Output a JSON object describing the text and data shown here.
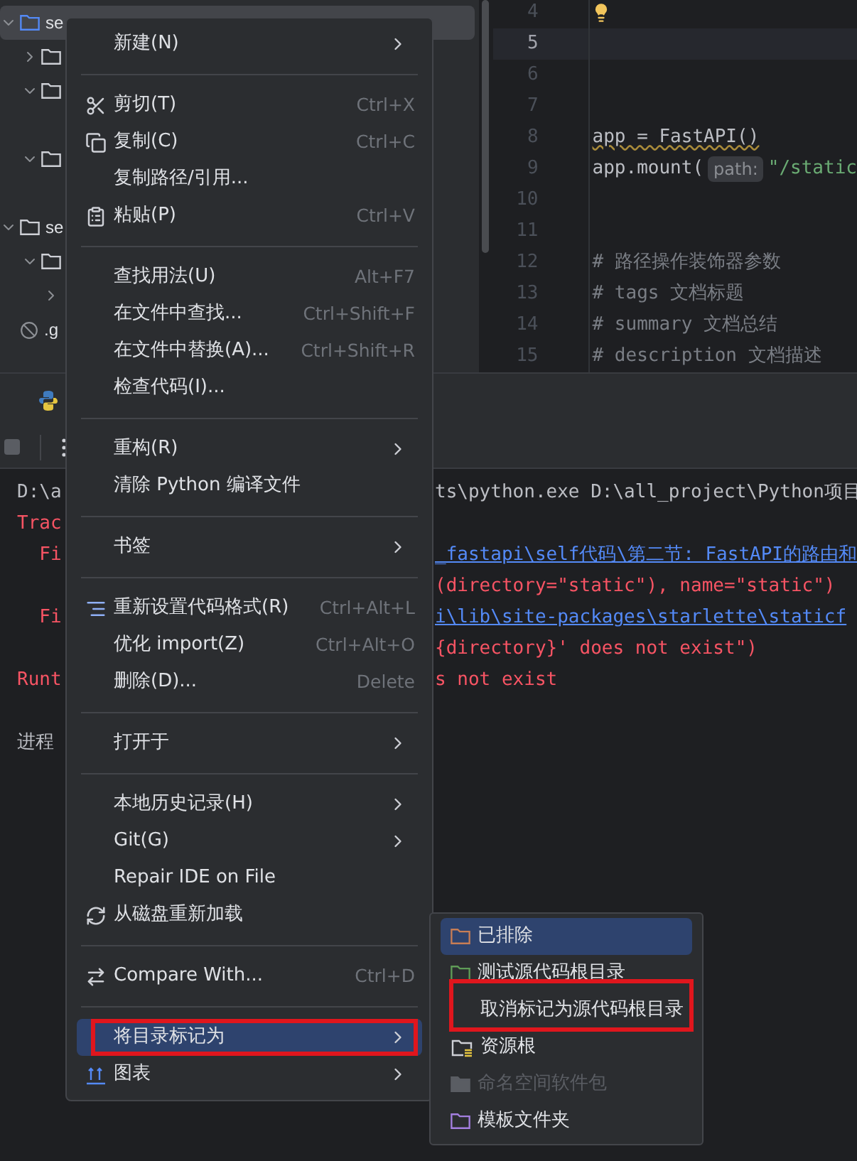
{
  "project_tree": [
    {
      "label": "se",
      "expanded": true,
      "selected": true,
      "children": [
        {
          "expanded": false
        },
        {
          "expanded": true
        },
        {
          "expanded": true
        }
      ]
    },
    {
      "label": "se",
      "expanded": true,
      "selected": false,
      "children": [
        {
          "expanded": true,
          "children": [
            {
              "expanded": false
            }
          ]
        }
      ]
    },
    {
      "label": ".g",
      "kind": "ignored",
      "selected": false
    }
  ],
  "editor": {
    "lines": [
      {
        "number": "4",
        "bulb": true,
        "current": false
      },
      {
        "number": "5",
        "bulb": false,
        "current": true
      },
      {
        "number": "6",
        "bulb": false,
        "current": false
      },
      {
        "number": "7",
        "bulb": false,
        "current": false
      },
      {
        "number": "8",
        "bulb": false,
        "current": false,
        "segments": [
          {
            "kind": "warn",
            "text": "app = FastAPI()"
          }
        ]
      },
      {
        "number": "9",
        "bulb": false,
        "current": false,
        "segments": [
          {
            "kind": "plain",
            "text": "app.mount("
          },
          {
            "kind": "hint",
            "text": "path:"
          },
          {
            "kind": "string",
            "text": "\"/static"
          }
        ]
      },
      {
        "number": "10",
        "bulb": false,
        "current": false
      },
      {
        "number": "11",
        "bulb": false,
        "current": false
      },
      {
        "number": "12",
        "bulb": false,
        "current": false,
        "segments": [
          {
            "kind": "comment",
            "text": "# 路径操作装饰器参数"
          }
        ]
      },
      {
        "number": "13",
        "bulb": false,
        "current": false,
        "segments": [
          {
            "kind": "comment",
            "text": "# tags 文档标题"
          }
        ]
      },
      {
        "number": "14",
        "bulb": false,
        "current": false,
        "segments": [
          {
            "kind": "comment",
            "text": "# summary 文档总结"
          }
        ]
      },
      {
        "number": "15",
        "bulb": false,
        "current": false,
        "segments": [
          {
            "kind": "comment",
            "text": "# description 文档描述"
          }
        ]
      }
    ]
  },
  "console": {
    "lines": [
      {
        "left": {
          "kind": "text",
          "text": "D:\\a"
        },
        "right": {
          "kind": "text",
          "text": "ts\\python.exe D:\\all_project\\Python项目"
        }
      },
      {
        "left": {
          "kind": "error",
          "text": "Trac"
        }
      },
      {
        "left": {
          "kind": "error",
          "text": "  Fi"
        },
        "right": {
          "kind": "link",
          "text": "_fastapi\\self代码\\第二节: FastAPI的路由和"
        }
      },
      {
        "right": {
          "kind": "error",
          "text": "(directory=\"static\"), name=\"static\")"
        }
      },
      {
        "left": {
          "kind": "error",
          "text": "  Fi"
        },
        "right": {
          "kind": "link",
          "text": "i\\lib\\site-packages\\starlette\\staticf"
        }
      },
      {
        "right": {
          "kind": "error",
          "text": "{directory}' does not exist\")"
        }
      },
      {
        "left": {
          "kind": "error",
          "text": "Runt"
        },
        "right": {
          "kind": "error",
          "text": "s not exist"
        }
      },
      {
        "gap_before": true,
        "left": {
          "kind": "text",
          "text": "进程"
        }
      }
    ]
  },
  "context_menu": {
    "items": [
      {
        "kind": "plain",
        "label": "新建(N)",
        "submenu": true,
        "selected": false
      },
      {
        "kind": "separator"
      },
      {
        "kind": "cut",
        "label": "剪切(T)",
        "shortcut": "Ctrl+X",
        "selected": false
      },
      {
        "kind": "copy",
        "label": "复制(C)",
        "shortcut": "Ctrl+C",
        "selected": false
      },
      {
        "kind": "plain",
        "label": "复制路径/引用...",
        "selected": false
      },
      {
        "kind": "paste",
        "label": "粘贴(P)",
        "shortcut": "Ctrl+V",
        "selected": false
      },
      {
        "kind": "separator"
      },
      {
        "kind": "plain",
        "label": "查找用法(U)",
        "shortcut": "Alt+F7",
        "selected": false
      },
      {
        "kind": "plain",
        "label": "在文件中查找...",
        "shortcut": "Ctrl+Shift+F",
        "selected": false
      },
      {
        "kind": "plain",
        "label": "在文件中替换(A)...",
        "shortcut": "Ctrl+Shift+R",
        "selected": false
      },
      {
        "kind": "plain",
        "label": "检查代码(I)...",
        "selected": false
      },
      {
        "kind": "separator"
      },
      {
        "kind": "plain",
        "label": "重构(R)",
        "submenu": true,
        "selected": false
      },
      {
        "kind": "plain",
        "label": "清除 Python 编译文件",
        "selected": false
      },
      {
        "kind": "separator"
      },
      {
        "kind": "plain",
        "label": "书签",
        "submenu": true,
        "selected": false
      },
      {
        "kind": "separator"
      },
      {
        "kind": "format",
        "label": "重新设置代码格式(R)",
        "shortcut": "Ctrl+Alt+L",
        "selected": false
      },
      {
        "kind": "plain",
        "label": "优化 import(Z)",
        "shortcut": "Ctrl+Alt+O",
        "selected": false
      },
      {
        "kind": "plain",
        "label": "删除(D)...",
        "shortcut": "Delete",
        "selected": false
      },
      {
        "kind": "separator"
      },
      {
        "kind": "plain",
        "label": "打开于",
        "submenu": true,
        "selected": false
      },
      {
        "kind": "separator"
      },
      {
        "kind": "plain",
        "label": "本地历史记录(H)",
        "submenu": true,
        "selected": false
      },
      {
        "kind": "plain",
        "label": "Git(G)",
        "submenu": true,
        "selected": false
      },
      {
        "kind": "plain",
        "label": "Repair IDE on File",
        "selected": false
      },
      {
        "kind": "reload",
        "label": "从磁盘重新加载",
        "selected": false
      },
      {
        "kind": "separator"
      },
      {
        "kind": "compare",
        "label": "Compare With...",
        "shortcut": "Ctrl+D",
        "selected": false
      },
      {
        "kind": "separator"
      },
      {
        "kind": "plain",
        "label": "将目录标记为",
        "submenu": true,
        "selected": true,
        "annotated": true
      },
      {
        "kind": "chart",
        "label": "图表",
        "submenu": true,
        "selected": false
      }
    ]
  },
  "submenu": {
    "items": [
      {
        "kind": "folder",
        "label": "已排除",
        "color": "#c77d55",
        "selected": true,
        "disabled": false
      },
      {
        "kind": "folder",
        "label": "测试源代码根目录",
        "color": "#5f9c57",
        "selected": false,
        "disabled": false
      },
      {
        "kind": "plain",
        "label": "取消标记为源代码根目录",
        "selected": false,
        "disabled": false,
        "annotated": true
      },
      {
        "kind": "resource",
        "label": "资源根",
        "selected": false,
        "disabled": false
      },
      {
        "kind": "folder",
        "label": "命名空间软件包",
        "color": "#5a5d63",
        "selected": false,
        "disabled": true
      },
      {
        "kind": "folder",
        "label": "模板文件夹",
        "color": "#a47fe0",
        "selected": false,
        "disabled": false
      }
    ]
  }
}
